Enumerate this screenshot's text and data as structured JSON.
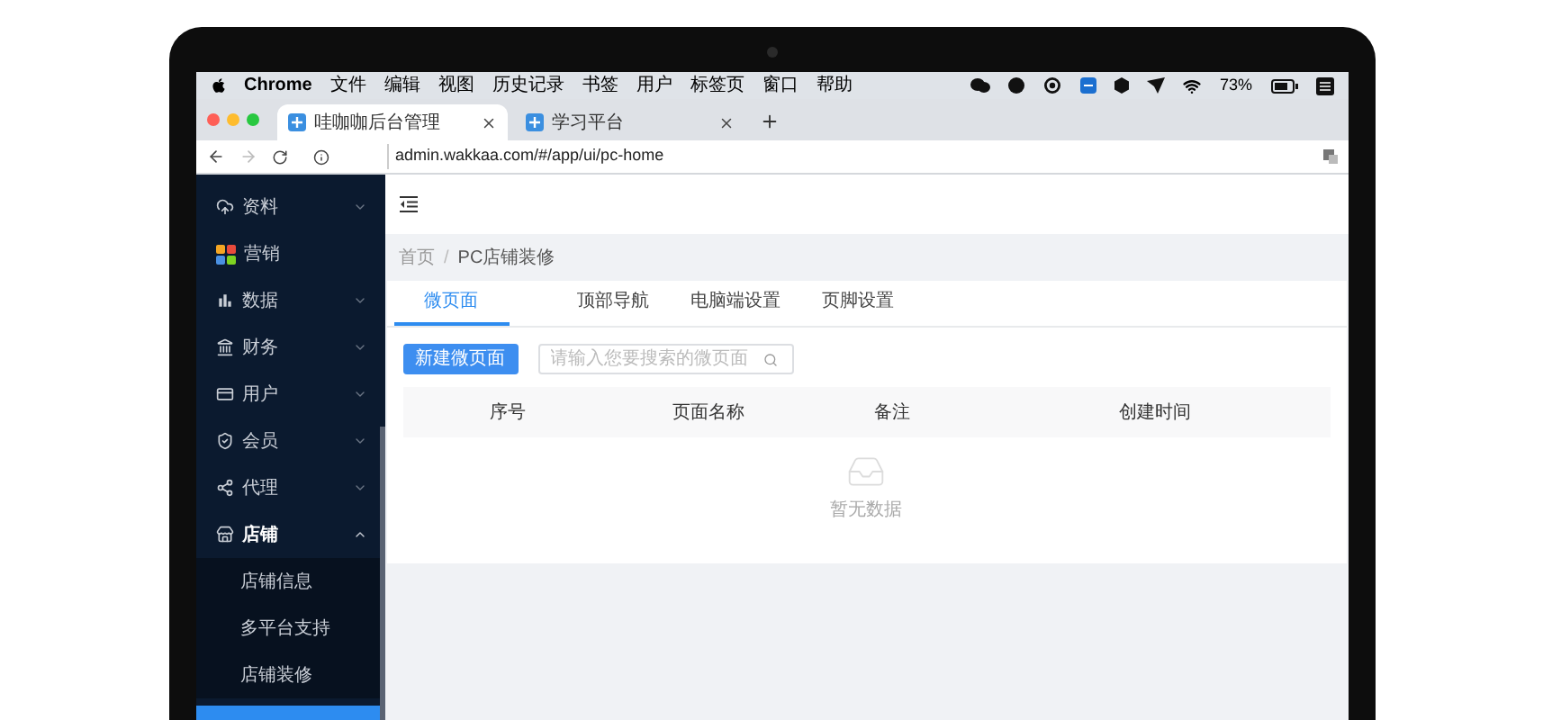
{
  "menu_bar": {
    "app": "Chrome",
    "items": [
      "文件",
      "编辑",
      "视图",
      "历史记录",
      "书签",
      "用户",
      "标签页",
      "窗口",
      "帮助"
    ],
    "battery": "73%"
  },
  "browser_tabs": [
    {
      "title": "哇咖咖后台管理",
      "selected": true
    },
    {
      "title": "学习平台",
      "selected": false
    }
  ],
  "address_bar": {
    "url": "admin.wakkaa.com/#/app/ui/pc-home"
  },
  "sidebar": {
    "items": [
      {
        "label": "资料",
        "kind": "group",
        "expanded": false
      },
      {
        "label": "营销",
        "kind": "link"
      },
      {
        "label": "数据",
        "kind": "group",
        "expanded": false
      },
      {
        "label": "财务",
        "kind": "group",
        "expanded": false
      },
      {
        "label": "用户",
        "kind": "group",
        "expanded": false
      },
      {
        "label": "会员",
        "kind": "group",
        "expanded": false
      },
      {
        "label": "代理",
        "kind": "group",
        "expanded": false
      },
      {
        "label": "店铺",
        "kind": "group",
        "expanded": true,
        "children": [
          {
            "label": "店铺信息",
            "selected": false
          },
          {
            "label": "多平台支持",
            "selected": false
          },
          {
            "label": "店铺装修",
            "selected": false
          }
        ]
      }
    ]
  },
  "breadcrumb": [
    "首页",
    "PC店铺装修"
  ],
  "breadcrumb_separator": "/",
  "tabs": [
    {
      "label": "微页面",
      "selected": true
    },
    {
      "label": "顶部导航",
      "selected": false
    },
    {
      "label": "电脑端设置",
      "selected": false
    },
    {
      "label": "页脚设置",
      "selected": false
    }
  ],
  "new_button": "新建微页面",
  "search": {
    "placeholder": "请输入您要搜索的微页面"
  },
  "table": {
    "columns": [
      "序号",
      "页面名称",
      "备注",
      "创建时间"
    ],
    "empty_text": "暂无数据"
  }
}
